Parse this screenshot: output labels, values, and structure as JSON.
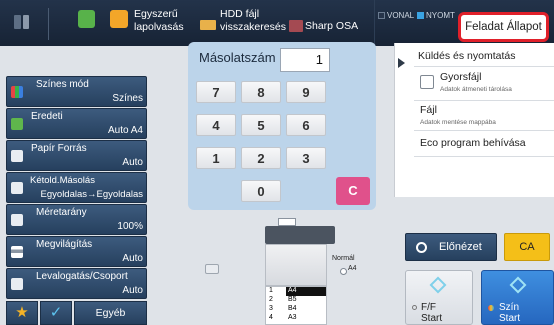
{
  "topbar": {
    "quick_scan_label": "Egyszerű\nlapolvasás",
    "hdd_label": "HDD fájl\nvisszakeresés",
    "sharp_osa_label": "Sharp OSA",
    "vonal_label": "VONAL",
    "nyomt_label": "NYOMT",
    "job_status_label": "Feladat Állapot"
  },
  "left_menu": [
    {
      "title": "Színes mód",
      "value": "Színes"
    },
    {
      "title": "Eredeti",
      "value": "Auto  A4"
    },
    {
      "title": "Papír Forrás",
      "value": "Auto"
    },
    {
      "title": "Kétold.Másolás",
      "value": "Egyoldalas→Egyoldalas"
    },
    {
      "title": "Méretarány",
      "value": "100%"
    },
    {
      "title": "Megvilágítás",
      "value": "Auto"
    },
    {
      "title": "Levalogatás/Csoport",
      "value": "Auto"
    }
  ],
  "bottom_left": {
    "other_label": "Egyéb"
  },
  "copy_count": {
    "label": "Másolatszám",
    "value": "1"
  },
  "keypad": {
    "keys": [
      "7",
      "8",
      "9",
      "4",
      "5",
      "6",
      "1",
      "2",
      "3",
      "0"
    ],
    "clear_label": "C"
  },
  "right_panel": {
    "send_print_label": "Küldés és nyomtatás",
    "quick_file_label": "Gyorsfájl",
    "quick_file_sub": "Adatok átmeneti tárolása",
    "file_label": "Fájl",
    "file_sub": "Adatok mentése mappába",
    "eco_label": "Eco program behívása"
  },
  "tray": {
    "normal_label": "Normál",
    "normal_size": "A4",
    "rows": [
      {
        "num": "1",
        "size": "A4"
      },
      {
        "num": "2",
        "size": "B5"
      },
      {
        "num": "3",
        "size": "B4"
      },
      {
        "num": "4",
        "size": "A3"
      }
    ]
  },
  "actions": {
    "preview_label": "Előnézet",
    "ca_label": "CA",
    "bw_label": "F/F",
    "bw_start": "Start",
    "color_label": "Szín",
    "color_start": "Start"
  },
  "colors": {
    "accent_red": "#e0202a",
    "ca_yellow": "#f4bf18",
    "clear_pink": "#e0518b",
    "start_blue": "#2f7fd6"
  }
}
